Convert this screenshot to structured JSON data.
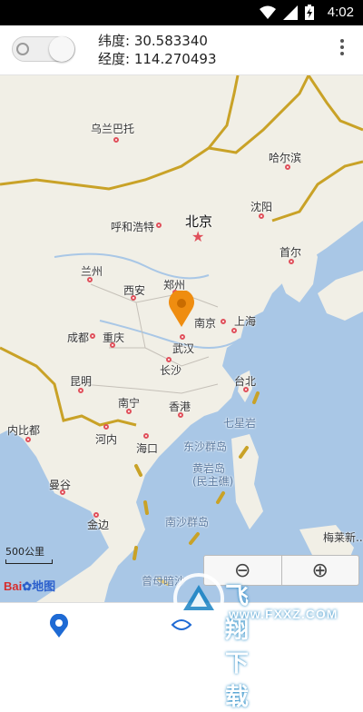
{
  "status_bar": {
    "time": "4:02"
  },
  "header": {
    "latitude": "纬度: 30.583340",
    "longitude": "经度: 114.270493"
  },
  "map": {
    "labels": {
      "wulanbatuo": "乌兰巴托",
      "haerbin": "哈尔滨",
      "shenyang": "沈阳",
      "huhehaote": "呼和浩特",
      "beijing": "北京",
      "shouer": "首尔",
      "lanzhou": "兰州",
      "xian": "西安",
      "zhengzhou": "郑州",
      "nanjing": "南京",
      "shanghai": "上海",
      "chengdu": "成都",
      "chongqing": "重庆",
      "wuhan": "武汉",
      "changsha": "长沙",
      "kunming": "昆明",
      "taibei": "台北",
      "nanning": "南宁",
      "xianggang": "香港",
      "qixingyan": "七星岩",
      "neibidu": "内比都",
      "henei": "河内",
      "haikou": "海口",
      "dongsha": "东沙群岛",
      "huangyan": "黄岩岛\n(民主礁)",
      "mangu": "曼谷",
      "jinbian": "金边",
      "nansha": "南沙群岛",
      "zengmu": "曾母暗沙",
      "malila": "梅莱新..."
    },
    "scale_label": "500公里",
    "logo_main": "Bai",
    "logo_suffix": "地图",
    "zoom_out": "⊖",
    "zoom_in": "⊕"
  },
  "watermark": {
    "text": "飞翔下载",
    "url": "www.FXXZ.COM"
  },
  "colors": {
    "land": "#f1efe6",
    "sea": "#a9c7e6",
    "border": "#c9a227",
    "marker": "#ef8d10",
    "nav_active": "#1e6ad4"
  }
}
